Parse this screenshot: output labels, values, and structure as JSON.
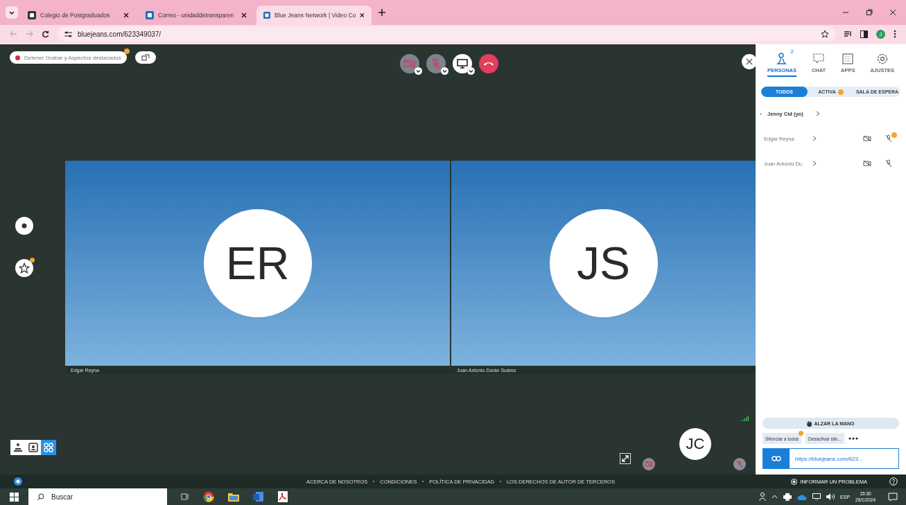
{
  "browser": {
    "tabs": [
      {
        "title": "Colegio de Postgraduados",
        "selected": false
      },
      {
        "title": "Correo - unidaddetransparen",
        "selected": false
      },
      {
        "title": "Blue Jeans Network | Video Co",
        "selected": true
      }
    ],
    "url": "bluejeans.com/623349037/",
    "profile_initial": "J"
  },
  "meeting": {
    "recording_label": "Detener Grabar y Aspectos destacados",
    "tiles": [
      {
        "initials": "ER",
        "name": "Edgar Reyna"
      },
      {
        "initials": "JS",
        "name": "Juan Antonio Durán Suárez"
      }
    ],
    "self_initials": "JC",
    "layout_views": [
      {
        "kind": "presenter",
        "selected": false
      },
      {
        "kind": "speaker",
        "selected": false
      },
      {
        "kind": "gallery",
        "selected": true
      }
    ],
    "footer_links": [
      "ACERCA DE NOSOTROS",
      "CONDICIONES",
      "POLÍTICA DE PRIVACIDAD",
      "LOS DERECHOS DE AUTOR DE TERCEROS"
    ]
  },
  "panel": {
    "tabs": [
      {
        "kind": "people",
        "label": "PERSONAS",
        "count": "2",
        "selected": true
      },
      {
        "kind": "chat",
        "label": "CHAT",
        "selected": false
      },
      {
        "kind": "apps",
        "label": "APPS",
        "selected": false
      },
      {
        "kind": "settings",
        "label": "AJUSTES",
        "selected": false
      }
    ],
    "filters": [
      {
        "label": "TODOS",
        "selected": true,
        "alert": false
      },
      {
        "label": "ACTIVA",
        "selected": false,
        "alert": true
      },
      {
        "label": "SALA DE ESPERA",
        "selected": false,
        "alert": false
      }
    ],
    "participants": [
      {
        "kind": "self",
        "name": "Jenny Cid (yo)"
      },
      {
        "kind": "guest",
        "name": "Edgar Reyna",
        "alert": true
      },
      {
        "kind": "guest",
        "name": "Juan Antonio Du",
        "alert": false
      }
    ],
    "raise_hand": "ALZAR LA MANO",
    "mute_all": "Silenciar a todos",
    "unmute": "Desactivar sile...",
    "link": "https://bluejeans.com/623 ..",
    "report": "INFORMAR UN PROBLEMA"
  },
  "taskbar": {
    "search_placeholder": "Buscar",
    "language": "ESP",
    "time": "15:30",
    "date": "26/1/2024"
  }
}
